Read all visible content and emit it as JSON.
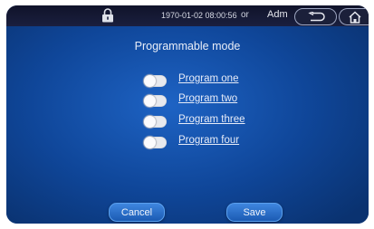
{
  "status_bar": {
    "datetime": "1970-01-02 08:00:56",
    "user_prefix": "or",
    "user_name": "Adm"
  },
  "page": {
    "title": "Programmable mode"
  },
  "programs": [
    {
      "label": "Program one",
      "enabled": false
    },
    {
      "label": "Program two",
      "enabled": false
    },
    {
      "label": "Program three",
      "enabled": false
    },
    {
      "label": "Program four",
      "enabled": false
    }
  ],
  "actions": {
    "cancel_label": "Cancel",
    "save_label": "Save"
  },
  "icons": {
    "lock": "lock-icon",
    "back": "back-arrow-icon",
    "home": "home-icon"
  },
  "colors": {
    "accent": "#1e63c4",
    "topbar": "#10132a",
    "button": "#2f73cc"
  }
}
